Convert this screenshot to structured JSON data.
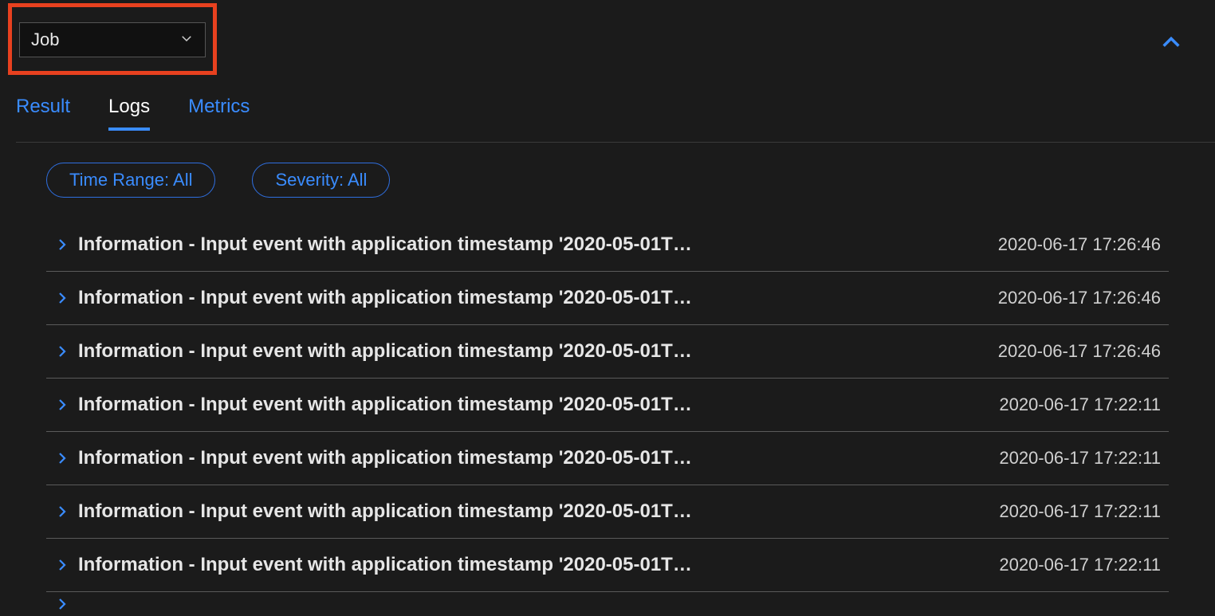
{
  "dropdown": {
    "selected": "Job"
  },
  "tabs": [
    {
      "label": "Result",
      "active": false
    },
    {
      "label": "Logs",
      "active": true
    },
    {
      "label": "Metrics",
      "active": false
    }
  ],
  "filters": {
    "timeRange": "Time Range: All",
    "severity": "Severity: All"
  },
  "logs": [
    {
      "message": "Information - Input event with application timestamp '2020-05-01T…",
      "timestamp": "2020-06-17 17:26:46"
    },
    {
      "message": "Information - Input event with application timestamp '2020-05-01T…",
      "timestamp": "2020-06-17 17:26:46"
    },
    {
      "message": "Information - Input event with application timestamp '2020-05-01T…",
      "timestamp": "2020-06-17 17:26:46"
    },
    {
      "message": "Information - Input event with application timestamp '2020-05-01T…",
      "timestamp": "2020-06-17 17:22:11"
    },
    {
      "message": "Information - Input event with application timestamp '2020-05-01T…",
      "timestamp": "2020-06-17 17:22:11"
    },
    {
      "message": "Information - Input event with application timestamp '2020-05-01T…",
      "timestamp": "2020-06-17 17:22:11"
    },
    {
      "message": "Information - Input event with application timestamp '2020-05-01T…",
      "timestamp": "2020-06-17 17:22:11"
    }
  ],
  "colors": {
    "accent": "#3a8cff",
    "highlight": "#e8411f",
    "background": "#1b1b1b"
  }
}
